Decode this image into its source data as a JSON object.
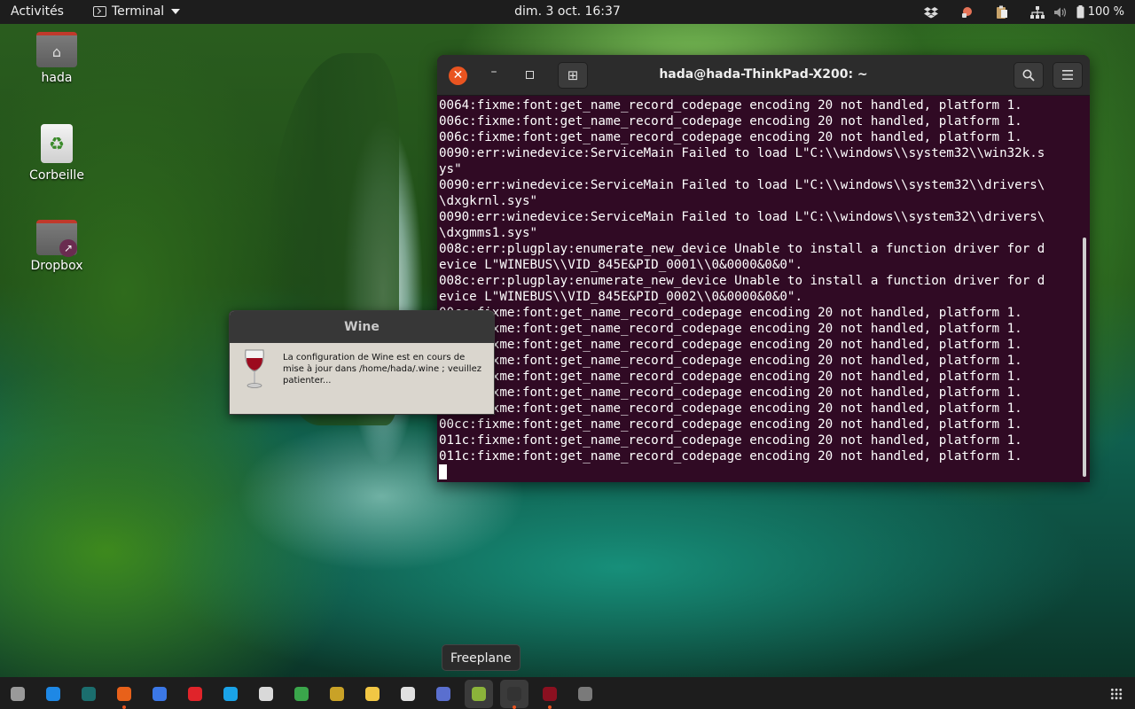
{
  "topbar": {
    "activities": "Activités",
    "app_name": "Terminal",
    "clock": "dim. 3 oct.  16:37",
    "battery": "100 %",
    "tray_icons": [
      "dropbox-icon",
      "keep-icon",
      "clipboard-icon",
      "network-icon",
      "volume-icon",
      "battery-icon"
    ]
  },
  "desktop": {
    "icons": [
      {
        "label": "hada",
        "icon": "home-folder-icon"
      },
      {
        "label": "Corbeille",
        "icon": "trash-icon"
      },
      {
        "label": "Dropbox",
        "icon": "folder-link-icon"
      }
    ]
  },
  "terminal": {
    "title": "hada@hada-ThinkPad-X200: ~",
    "lines": [
      "0064:fixme:font:get_name_record_codepage encoding 20 not handled, platform 1.",
      "006c:fixme:font:get_name_record_codepage encoding 20 not handled, platform 1.",
      "006c:fixme:font:get_name_record_codepage encoding 20 not handled, platform 1.",
      "0090:err:winedevice:ServiceMain Failed to load L\"C:\\\\windows\\\\system32\\\\win32k.s",
      "ys\"",
      "0090:err:winedevice:ServiceMain Failed to load L\"C:\\\\windows\\\\system32\\\\drivers\\",
      "\\dxgkrnl.sys\"",
      "0090:err:winedevice:ServiceMain Failed to load L\"C:\\\\windows\\\\system32\\\\drivers\\",
      "\\dxgmms1.sys\"",
      "008c:err:plugplay:enumerate_new_device Unable to install a function driver for d",
      "evice L\"WINEBUS\\\\VID_845E&PID_0001\\\\0&0000&0&0\".",
      "008c:err:plugplay:enumerate_new_device Unable to install a function driver for d",
      "evice L\"WINEBUS\\\\VID_845E&PID_0002\\\\0&0000&0&0\".",
      "00cc:fixme:font:get_name_record_codepage encoding 20 not handled, platform 1.",
      "00cc:fixme:font:get_name_record_codepage encoding 20 not handled, platform 1.",
      "00cc:fixme:font:get_name_record_codepage encoding 20 not handled, platform 1.",
      "00cc:fixme:font:get_name_record_codepage encoding 20 not handled, platform 1.",
      "00cc:fixme:font:get_name_record_codepage encoding 20 not handled, platform 1.",
      "00cc:fixme:font:get_name_record_codepage encoding 20 not handled, platform 1.",
      "00cc:fixme:font:get_name_record_codepage encoding 20 not handled, platform 1.",
      "00cc:fixme:font:get_name_record_codepage encoding 20 not handled, platform 1.",
      "011c:fixme:font:get_name_record_codepage encoding 20 not handled, platform 1.",
      "011c:fixme:font:get_name_record_codepage encoding 20 not handled, platform 1."
    ]
  },
  "wine_dialog": {
    "title": "Wine",
    "message": "La configuration de Wine est en cours de mise à jour dans /home/hada/.wine ; veuillez patienter..."
  },
  "tooltip": "Freeplane",
  "dock": {
    "apps": [
      {
        "name": "files-icon",
        "color": "#9a9a9a",
        "running": false
      },
      {
        "name": "vscode-icon",
        "color": "#1e88e5",
        "running": false
      },
      {
        "name": "keepassxc-icon",
        "color": "#1b6e6e",
        "running": false
      },
      {
        "name": "firefox-icon",
        "color": "#e8611a",
        "running": true
      },
      {
        "name": "chromium-icon",
        "color": "#3b78e7",
        "running": false
      },
      {
        "name": "opera-icon",
        "color": "#e0242a",
        "running": false
      },
      {
        "name": "skype-icon",
        "color": "#1aa3e8",
        "running": false
      },
      {
        "name": "slack-icon",
        "color": "#d9d9d9",
        "running": false
      },
      {
        "name": "yed-icon",
        "color": "#3aa64b",
        "running": false
      },
      {
        "name": "spotify-like-icon",
        "color": "#c9a227",
        "running": false
      },
      {
        "name": "text-editor-icon",
        "color": "#f2c744",
        "running": false
      },
      {
        "name": "pdf-viewer-icon",
        "color": "#e0e0e0",
        "running": false
      },
      {
        "name": "screenshot-icon",
        "color": "#5a6fcf",
        "running": false
      },
      {
        "name": "freeplane-icon",
        "color": "#8bb33a",
        "running": false,
        "active": true
      },
      {
        "name": "terminal-icon",
        "color": "#333333",
        "running": true,
        "active": true
      },
      {
        "name": "wine-icon",
        "color": "#8b1020",
        "running": true
      },
      {
        "name": "disks-icon",
        "color": "#7a7a7a",
        "running": false
      }
    ]
  }
}
